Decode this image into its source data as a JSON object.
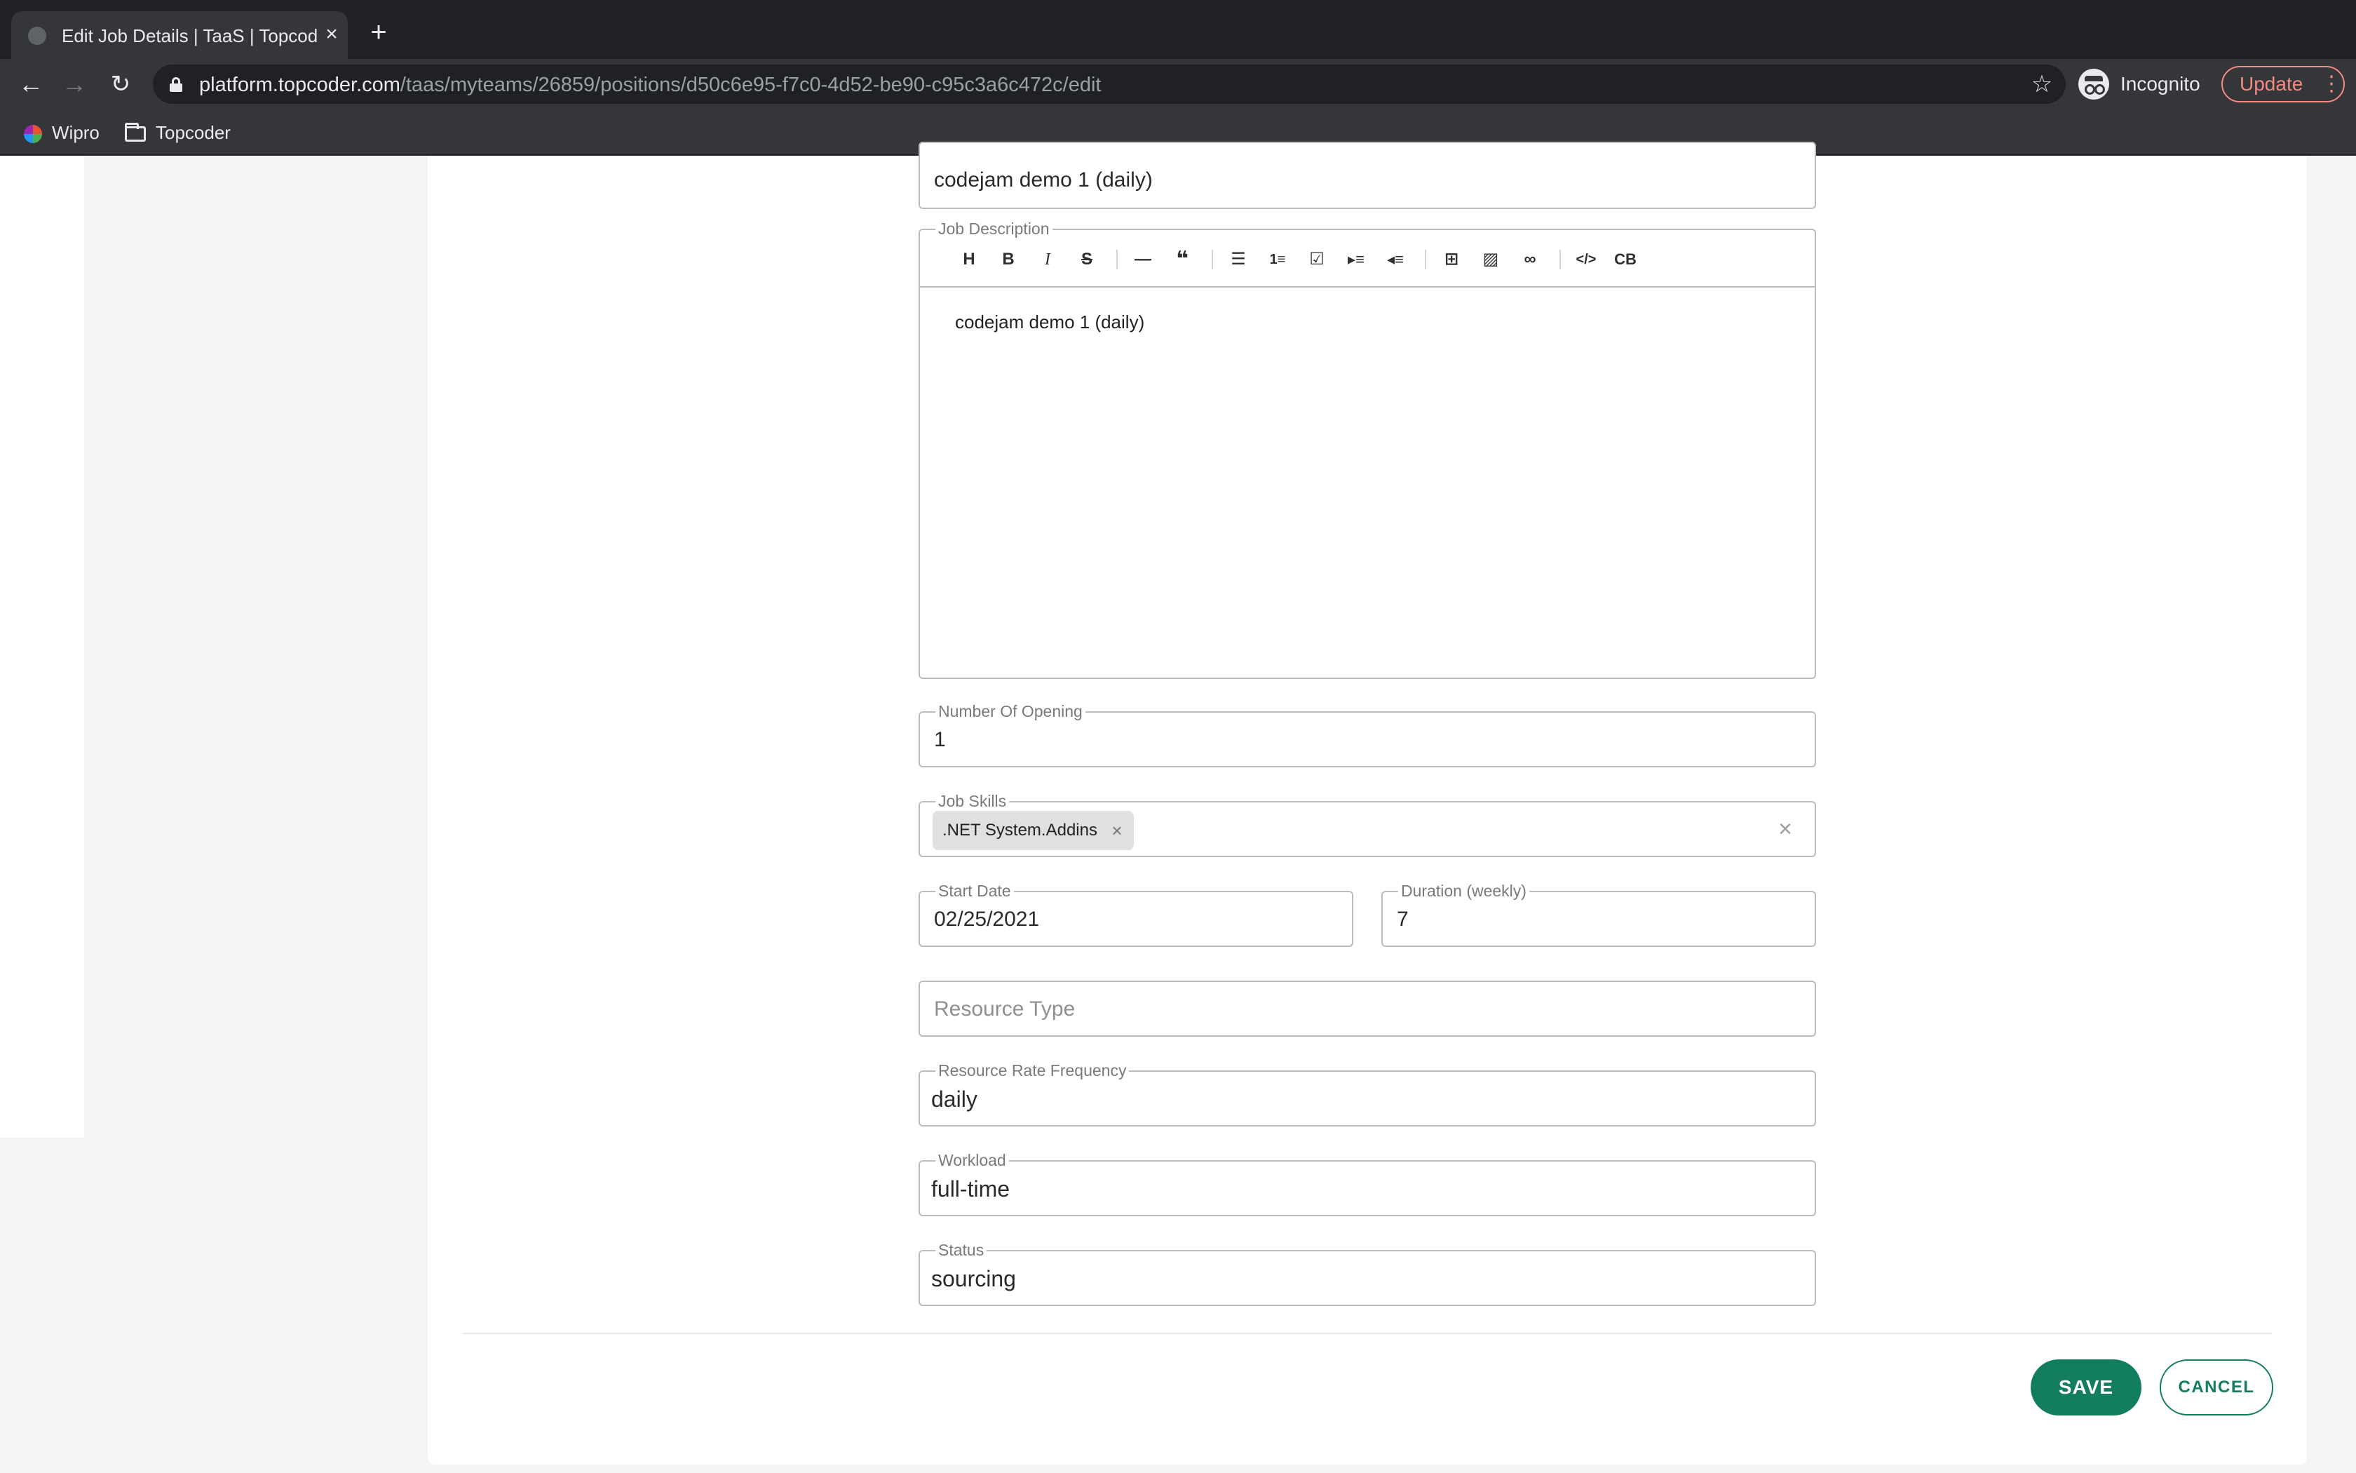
{
  "browser": {
    "tab_title": "Edit Job Details | TaaS | Topcoder",
    "url_host": "platform.topcoder.com",
    "url_path": "/taas/myteams/26859/positions/d50c6e95-f7c0-4d52-be90-c95c3a6c472c/edit",
    "incognito_label": "Incognito",
    "update_label": "Update",
    "bookmarks": [
      {
        "label": "Wipro"
      },
      {
        "label": "Topcoder"
      }
    ]
  },
  "form": {
    "job_title_value": "codejam demo 1 (daily)",
    "job_description": {
      "legend": "Job Description",
      "body": "codejam demo 1 (daily)",
      "toolbar": [
        "H",
        "B",
        "I",
        "S",
        "—",
        "❝",
        "list",
        "ordered-list",
        "check",
        "indent",
        "outdent",
        "table",
        "image",
        "link",
        "code",
        "CB"
      ]
    },
    "number_of_opening": {
      "legend": "Number Of Opening",
      "value": "1"
    },
    "job_skills": {
      "legend": "Job Skills",
      "chip": ".NET System.Addins"
    },
    "start_date": {
      "legend": "Start Date",
      "value": "02/25/2021"
    },
    "duration": {
      "legend": "Duration (weekly)",
      "value": "7"
    },
    "resource_type": {
      "placeholder": "Resource Type"
    },
    "resource_rate_frequency": {
      "legend": "Resource Rate Frequency",
      "value": "daily"
    },
    "workload": {
      "legend": "Workload",
      "value": "full-time"
    },
    "status": {
      "legend": "Status",
      "value": "sourcing"
    }
  },
  "actions": {
    "save_label": "SAVE",
    "cancel_label": "CANCEL"
  },
  "colors": {
    "brand_green": "#137d60",
    "chrome_dark": "#202124",
    "chrome_toolbar": "#35363a"
  }
}
